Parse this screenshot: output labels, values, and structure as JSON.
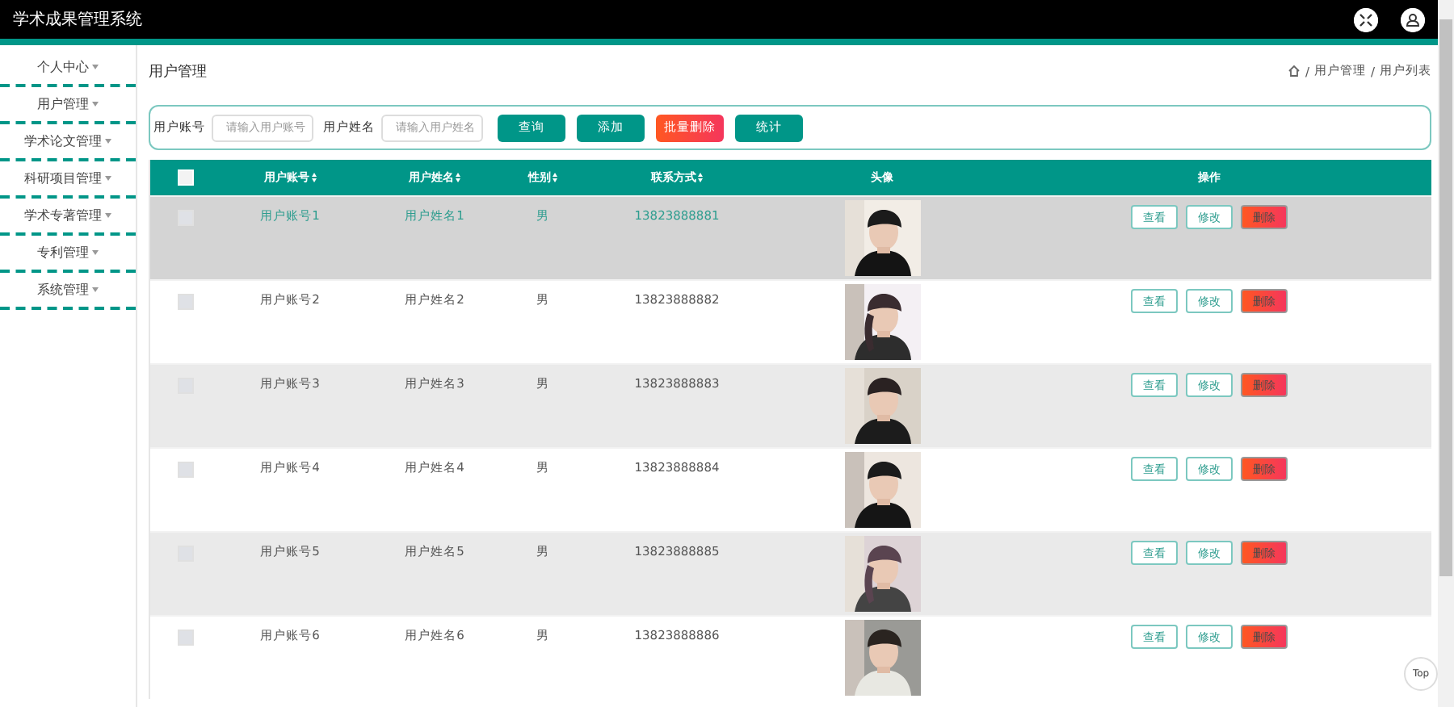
{
  "header": {
    "title": "学术成果管理系统"
  },
  "sidebar": {
    "items": [
      {
        "label": "个人中心",
        "expanded": false
      },
      {
        "label": "用户管理",
        "expanded": false
      },
      {
        "label": "学术论文管理",
        "expanded": false
      },
      {
        "label": "科研项目管理",
        "expanded": false
      },
      {
        "label": "学术专著管理",
        "expanded": false
      },
      {
        "label": "专利管理",
        "expanded": false
      },
      {
        "label": "系统管理",
        "expanded": false
      }
    ]
  },
  "page_title": "用户管理",
  "breadcrumb": [
    "/",
    "用户管理",
    "/",
    "用户列表"
  ],
  "search": {
    "fields": [
      {
        "label": "用户账号",
        "placeholder": "请输入用户账号"
      },
      {
        "label": "用户姓名",
        "placeholder": "请输入用户姓名"
      }
    ],
    "buttons": [
      {
        "label": "查询",
        "kind": "primary"
      },
      {
        "label": "添加",
        "kind": "primary"
      },
      {
        "label": "批量删除",
        "kind": "danger"
      },
      {
        "label": "统计",
        "kind": "primary"
      }
    ]
  },
  "table": {
    "select_all": {
      "checked": false
    },
    "columns": [
      {
        "label": "用户账号",
        "sortable": true
      },
      {
        "label": "用户姓名",
        "sortable": true
      },
      {
        "label": "性别",
        "sortable": true
      },
      {
        "label": "联系方式",
        "sortable": true
      },
      {
        "label": "头像",
        "sortable": false
      },
      {
        "label": "操作",
        "sortable": false
      }
    ],
    "rows": [
      {
        "selected": true,
        "checked": false,
        "account": "用户账号1",
        "name": "用户姓名1",
        "gender": "男",
        "phone": "13823888881",
        "avatar": {
          "kind": "picture"
        },
        "actions": [
          "查看",
          "修改",
          "删除"
        ]
      },
      {
        "selected": false,
        "checked": false,
        "account": "用户账号2",
        "name": "用户姓名2",
        "gender": "男",
        "phone": "13823888882",
        "avatar": {
          "kind": "picture"
        },
        "actions": [
          "查看",
          "修改",
          "删除"
        ]
      },
      {
        "selected": false,
        "checked": false,
        "account": "用户账号3",
        "name": "用户姓名3",
        "gender": "男",
        "phone": "13823888883",
        "avatar": {
          "kind": "picture"
        },
        "actions": [
          "查看",
          "修改",
          "删除"
        ]
      },
      {
        "selected": false,
        "checked": false,
        "account": "用户账号4",
        "name": "用户姓名4",
        "gender": "男",
        "phone": "13823888884",
        "avatar": {
          "kind": "picture"
        },
        "actions": [
          "查看",
          "修改",
          "删除"
        ]
      },
      {
        "selected": false,
        "checked": false,
        "account": "用户账号5",
        "name": "用户姓名5",
        "gender": "男",
        "phone": "13823888885",
        "avatar": {
          "kind": "picture"
        },
        "actions": [
          "查看",
          "修改",
          "删除"
        ]
      },
      {
        "selected": false,
        "checked": false,
        "account": "用户账号6",
        "name": "用户姓名6",
        "gender": "男",
        "phone": "13823888886",
        "avatar": {
          "kind": "picture"
        },
        "actions": [
          "查看",
          "修改",
          "删除"
        ]
      }
    ]
  },
  "back_to_top": "Top"
}
